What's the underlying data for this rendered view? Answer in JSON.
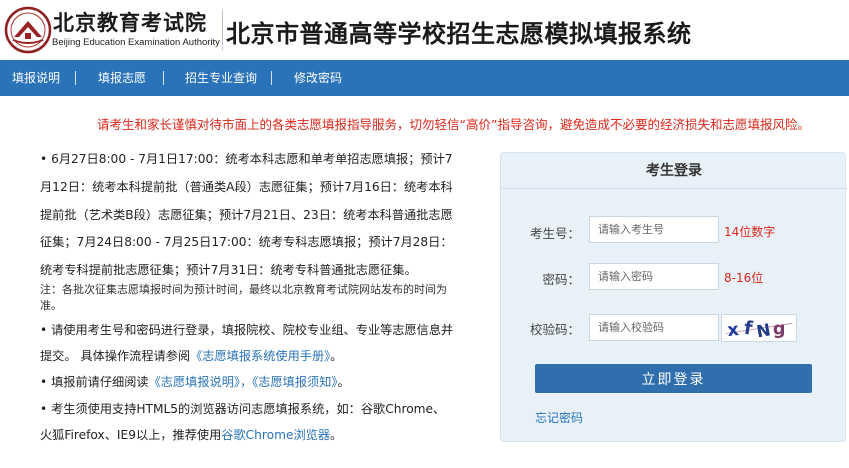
{
  "header": {
    "logo_cn": "北京教育考试院",
    "logo_en": "Beijing Education Examination Authority",
    "system_title": "北京市普通高等学校招生志愿模拟填报系统"
  },
  "nav": {
    "items": [
      {
        "label": "填报说明"
      },
      {
        "label": "填报志愿"
      },
      {
        "label": "招生专业查询"
      },
      {
        "label": "修改密码"
      }
    ]
  },
  "warning": "请考生和家长谨慎对待市面上的各类志愿填报指导服务，切勿轻信“高价”指导咨询，避免造成不必要的经济损失和志愿填报风险。",
  "info": {
    "schedule_lines": [
      "• 6月27日8:00 - 7月1日17:00：统考本科志愿和单考单招志愿填报；预计7",
      "月12日：统考本科提前批（普通类A段）志愿征集；预计7月16日：统考本科",
      "提前批（艺术类B段）志愿征集；预计7月21日、23日：统考本科普通批志愿",
      "征集；7月24日8:00 - 7月25日17:00：统考专科志愿填报；预计7月28日：",
      "统考专科提前批志愿征集；预计7月31日：统考专科普通批志愿征集。"
    ],
    "note_lines": [
      "注：各批次征集志愿填报时间为预计时间，最终以北京教育考试院网站发布的时间为",
      "准。"
    ],
    "login_line1": "• 请使用考生号和密码进行登录，填报院校、院校专业组、专业等志愿信息并",
    "login_line2_prefix": "提交。 具体操作流程请参阅",
    "manual_link": "《志愿填报系统使用手册》",
    "period": "。",
    "read_prefix": "• 填报前请仔细阅读",
    "read_link1": "《志愿填报说明》",
    "read_comma": "，",
    "read_link2": "《志愿填报须知》",
    "read_period": "。",
    "browser_line1": "• 考生须使用支持HTML5的浏览器访问志愿填报系统，如：谷歌Chrome、",
    "browser_line2_prefix": "火狐Firefox、IE9以上，推荐使用",
    "chrome_link": "谷歌Chrome浏览器",
    "browser_period": "。"
  },
  "login": {
    "title": "考生登录",
    "examinee_label": "考生号：",
    "examinee_placeholder": "请输入考生号",
    "examinee_hint": "14位数字",
    "password_label": "密码：",
    "password_placeholder": "请输入密码",
    "password_hint": "8-16位",
    "captcha_label": "校验码：",
    "captcha_placeholder": "请输入校验码",
    "captcha_text": "xfNg",
    "submit": "立即登录",
    "forgot": "忘记密码"
  },
  "colors": {
    "nav_bg": "#2a73b8",
    "warning": "#d9281a",
    "link": "#2a73b8",
    "button": "#2f6fae",
    "card_bg": "#e9f1f8"
  }
}
